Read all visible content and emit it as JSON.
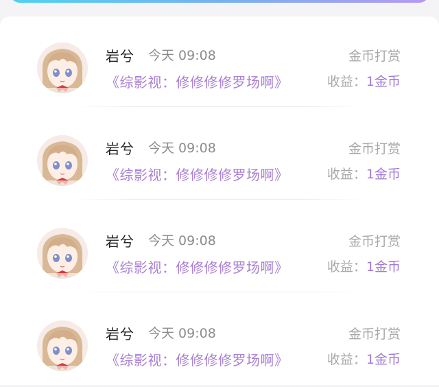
{
  "records": [
    {
      "username": "岩兮",
      "time": "今天 09:08",
      "type": "金币打赏",
      "book": "《综影视：修修修修罗场啊》",
      "earn_label": "收益：",
      "earn_value": "1金币"
    },
    {
      "username": "岩兮",
      "time": "今天 09:08",
      "type": "金币打赏",
      "book": "《综影视：修修修修罗场啊》",
      "earn_label": "收益：",
      "earn_value": "1金币"
    },
    {
      "username": "岩兮",
      "time": "今天 09:08",
      "type": "金币打赏",
      "book": "《综影视：修修修修罗场啊》",
      "earn_label": "收益：",
      "earn_value": "1金币"
    },
    {
      "username": "岩兮",
      "time": "今天 09:08",
      "type": "金币打赏",
      "book": "《综影视：修修修修罗场啊》",
      "earn_label": "收益：",
      "earn_value": "1金币"
    }
  ],
  "colors": {
    "accent_purple": "#a981d6",
    "gradient_start": "#4ed3ee",
    "gradient_end": "#b69af0"
  },
  "icons": {
    "avatar": "anime-girl-avatar-icon"
  }
}
